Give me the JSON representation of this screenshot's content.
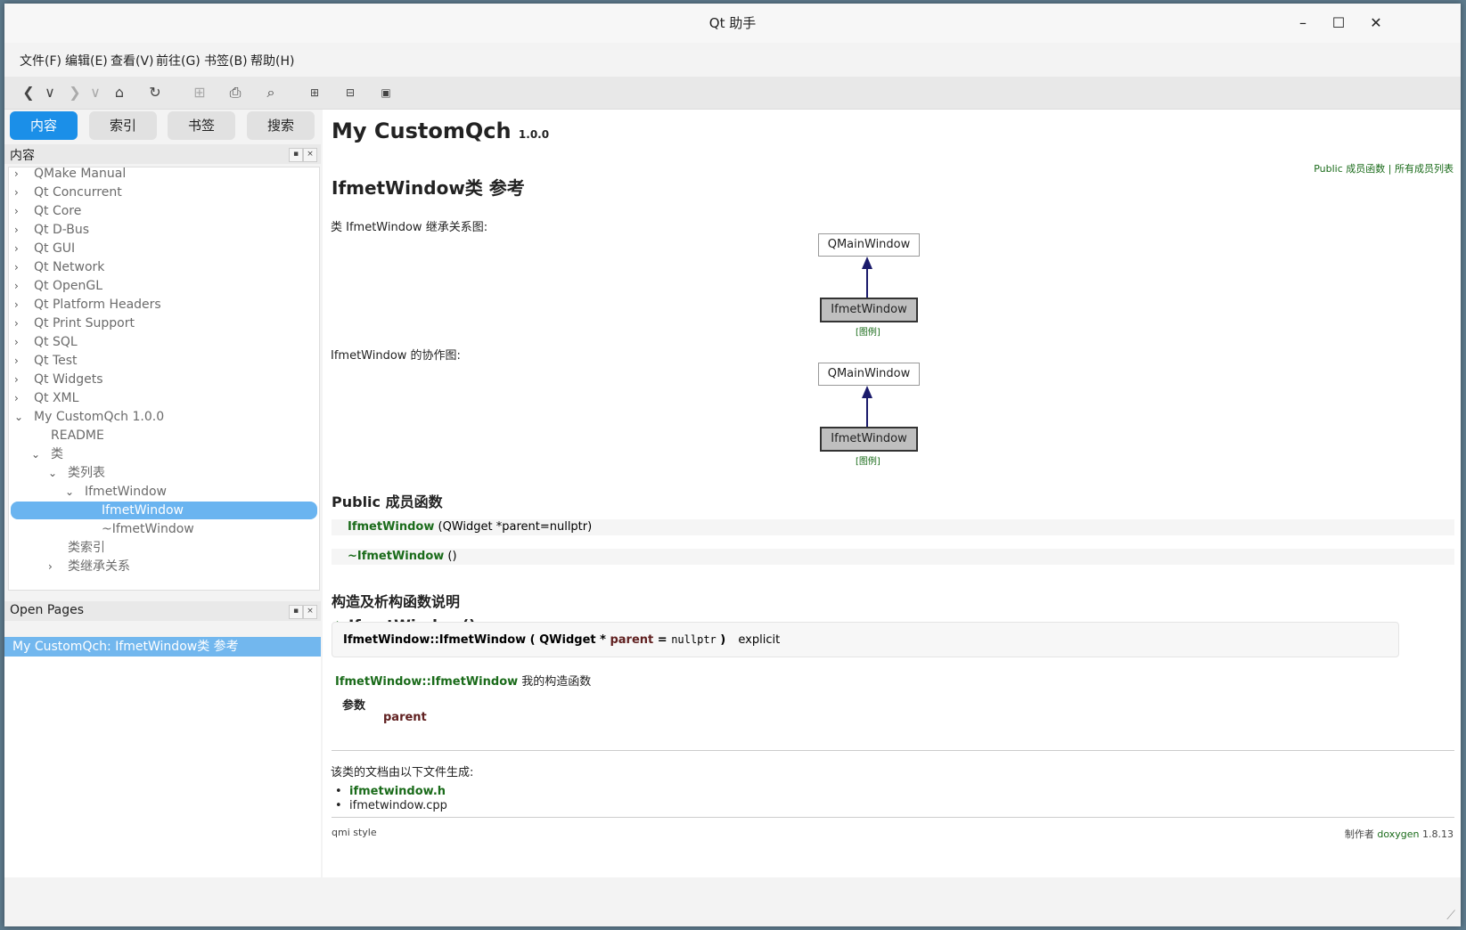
{
  "window": {
    "title": "Qt 助手",
    "minimize": "–",
    "maximize": "☐",
    "close": "✕"
  },
  "menu": [
    "文件(F)",
    "编辑(E)",
    "查看(V)",
    "前往(G)",
    "书签(B)",
    "帮助(H)"
  ],
  "toolbar": {
    "icons": [
      "back-icon",
      "back-menu-icon",
      "forward-icon",
      "forward-menu-icon",
      "home-icon",
      "reload-icon",
      "add-bookmark-icon",
      "print-icon",
      "find-icon",
      "zoom-in-icon",
      "zoom-out-icon",
      "reset-zoom-icon"
    ],
    "glyphs": {
      "back": "❮",
      "back_menu": "∨",
      "forward": "❯",
      "forward_menu": "∨",
      "home": "⌂",
      "reload": "↻",
      "add_bookmark": "⊞",
      "print": "⎙",
      "find": "⌕",
      "zoom_in": "⊞",
      "zoom_out": "⊟",
      "reset_zoom": "▣"
    }
  },
  "tabs": [
    {
      "label": "内容",
      "active": true
    },
    {
      "label": "索引",
      "active": false
    },
    {
      "label": "书签",
      "active": false
    },
    {
      "label": "搜索",
      "active": false
    }
  ],
  "contents_dock": {
    "title": "内容",
    "float_btn": "▪",
    "close_btn": "×",
    "tree": [
      {
        "label": "QMake Manual",
        "arrow": "›",
        "indent": 0
      },
      {
        "label": "Qt Concurrent",
        "arrow": "›",
        "indent": 0
      },
      {
        "label": "Qt Core",
        "arrow": "›",
        "indent": 0
      },
      {
        "label": "Qt D-Bus",
        "arrow": "›",
        "indent": 0
      },
      {
        "label": "Qt GUI",
        "arrow": "›",
        "indent": 0
      },
      {
        "label": "Qt Network",
        "arrow": "›",
        "indent": 0
      },
      {
        "label": "Qt OpenGL",
        "arrow": "›",
        "indent": 0
      },
      {
        "label": "Qt Platform Headers",
        "arrow": "›",
        "indent": 0
      },
      {
        "label": "Qt Print Support",
        "arrow": "›",
        "indent": 0
      },
      {
        "label": "Qt SQL",
        "arrow": "›",
        "indent": 0
      },
      {
        "label": "Qt Test",
        "arrow": "›",
        "indent": 0
      },
      {
        "label": "Qt Widgets",
        "arrow": "›",
        "indent": 0
      },
      {
        "label": "Qt XML",
        "arrow": "›",
        "indent": 0
      },
      {
        "label": "My CustomQch 1.0.0",
        "arrow": "⌄",
        "indent": 0
      },
      {
        "label": "README",
        "arrow": "",
        "indent": 1
      },
      {
        "label": "类",
        "arrow": "⌄",
        "indent": 1
      },
      {
        "label": "类列表",
        "arrow": "⌄",
        "indent": 2
      },
      {
        "label": "IfmetWindow",
        "arrow": "⌄",
        "indent": 3
      },
      {
        "label": "IfmetWindow",
        "arrow": "",
        "indent": 4,
        "selected": true
      },
      {
        "label": "~IfmetWindow",
        "arrow": "",
        "indent": 4
      },
      {
        "label": "类索引",
        "arrow": "",
        "indent": 2
      },
      {
        "label": "类继承关系",
        "arrow": "›",
        "indent": 2
      }
    ]
  },
  "open_pages_dock": {
    "title": "Open Pages",
    "float_btn": "▪",
    "close_btn": "×",
    "items": [
      "My CustomQch: IfmetWindow类 参考"
    ]
  },
  "doc": {
    "project": "My CustomQch",
    "version": "1.0.0",
    "nav_public": "Public 成员函数",
    "nav_sep": " | ",
    "nav_all": "所有成员列表",
    "class_title": "IfmetWindow类 参考",
    "inherit_caption": "类 IfmetWindow 继承关系图:",
    "collab_caption": "IfmetWindow 的协作图:",
    "diagram_parent": "QMainWindow",
    "diagram_child": "IfmetWindow",
    "legend": "[图例]",
    "public_title": "Public 成员函数",
    "members": [
      {
        "name": "IfmetWindow",
        "args": " (QWidget *parent=nullptr)"
      },
      {
        "name": "~IfmetWindow",
        "args": " ()"
      }
    ],
    "ctor_section": "构造及析构函数说明",
    "ctor_heading": "◆ IfmetWindow()",
    "sig_name": "IfmetWindow::IfmetWindow ( QWidget * ",
    "sig_param": "parent",
    "sig_eq": " = ",
    "sig_default": "nullptr",
    "sig_close": " )",
    "sig_qualifier": "explicit",
    "desc_link": "IfmetWindow::IfmetWindow",
    "desc_text": " 我的构造函数",
    "params_label": "参数",
    "param_name": "parent",
    "generated_from": "该类的文档由以下文件生成:",
    "files": [
      {
        "name": "ifmetwindow.h",
        "link": true
      },
      {
        "name": "ifmetwindow.cpp",
        "link": false
      }
    ],
    "footer_left": "qmi style",
    "footer_right_prefix": "制作者 ",
    "footer_right_link": "doxygen",
    "footer_right_version": " 1.8.13"
  },
  "colors": {
    "accent": "#1b8fe8",
    "link_green": "#1a6b1a",
    "selection": "#6ab4f0",
    "arrow_navy": "#1a1a6b"
  }
}
